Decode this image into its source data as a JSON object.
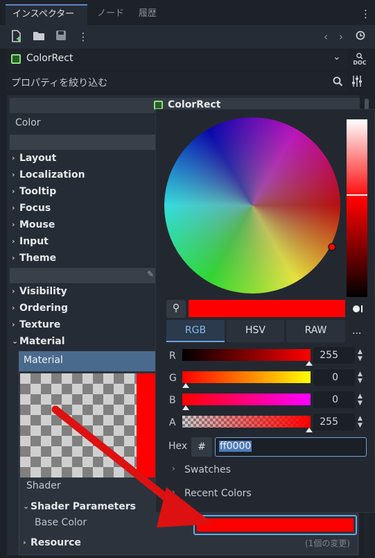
{
  "tabs": [
    "インスペクター",
    "ノード",
    "履歴"
  ],
  "toolbar": {
    "new_icon": "new-resource-icon",
    "open_icon": "folder-icon",
    "save_icon": "save-icon",
    "more_icon": "kebab-menu-icon",
    "back_icon": "chevron-left-icon",
    "forward_icon": "chevron-right-icon",
    "history_icon": "history-icon"
  },
  "node_selector": {
    "name": "ColorRect",
    "doc_label": "DOC"
  },
  "filter": {
    "placeholder": "プロパティを絞り込む"
  },
  "inspector": {
    "class_header": "ColorRect",
    "color_label": "Color",
    "sections": [
      "Layout",
      "Localization",
      "Tooltip",
      "Focus",
      "Mouse",
      "Input",
      "Theme"
    ],
    "sections2": [
      "Visibility",
      "Ordering",
      "Texture",
      "Material"
    ],
    "material_label": "Material",
    "shader_label": "Shader",
    "shader_params": "Shader Parameters",
    "base_color": "Base Color",
    "resource": "Resource",
    "changes": "(1個の変更)"
  },
  "picker": {
    "selected_color": "#ff0000",
    "mode_tabs": [
      "RGB",
      "HSV",
      "RAW"
    ],
    "more": "...",
    "channels": [
      {
        "name": "R",
        "value": "255",
        "level": 1.0
      },
      {
        "name": "G",
        "value": "0",
        "level": 0.0
      },
      {
        "name": "B",
        "value": "0",
        "level": 0.0
      },
      {
        "name": "A",
        "value": "255",
        "level": 1.0
      }
    ],
    "hex_label": "Hex",
    "hash": "#",
    "hex_value": "ff0000",
    "swatches": "Swatches",
    "recent": "Recent Colors"
  }
}
